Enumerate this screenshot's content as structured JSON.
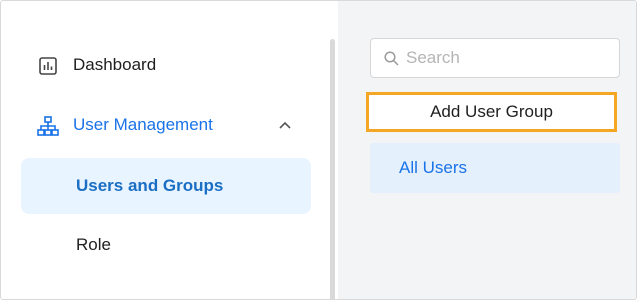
{
  "sidebar": {
    "items": [
      {
        "label": "Dashboard",
        "icon": "chart-icon"
      },
      {
        "label": "User Management",
        "icon": "org-chart-icon",
        "expanded": true,
        "children": [
          {
            "label": "Users and Groups",
            "active": true
          },
          {
            "label": "Role"
          }
        ]
      }
    ]
  },
  "panel": {
    "search": {
      "placeholder": "Search"
    },
    "add_button_label": "Add User Group",
    "groups": [
      {
        "label": "All Users"
      }
    ]
  },
  "colors": {
    "accent": "#1a73e8",
    "active_bg": "#e8f4ff",
    "highlight_border": "#f5a623",
    "panel_bg": "#f3f4f6"
  }
}
